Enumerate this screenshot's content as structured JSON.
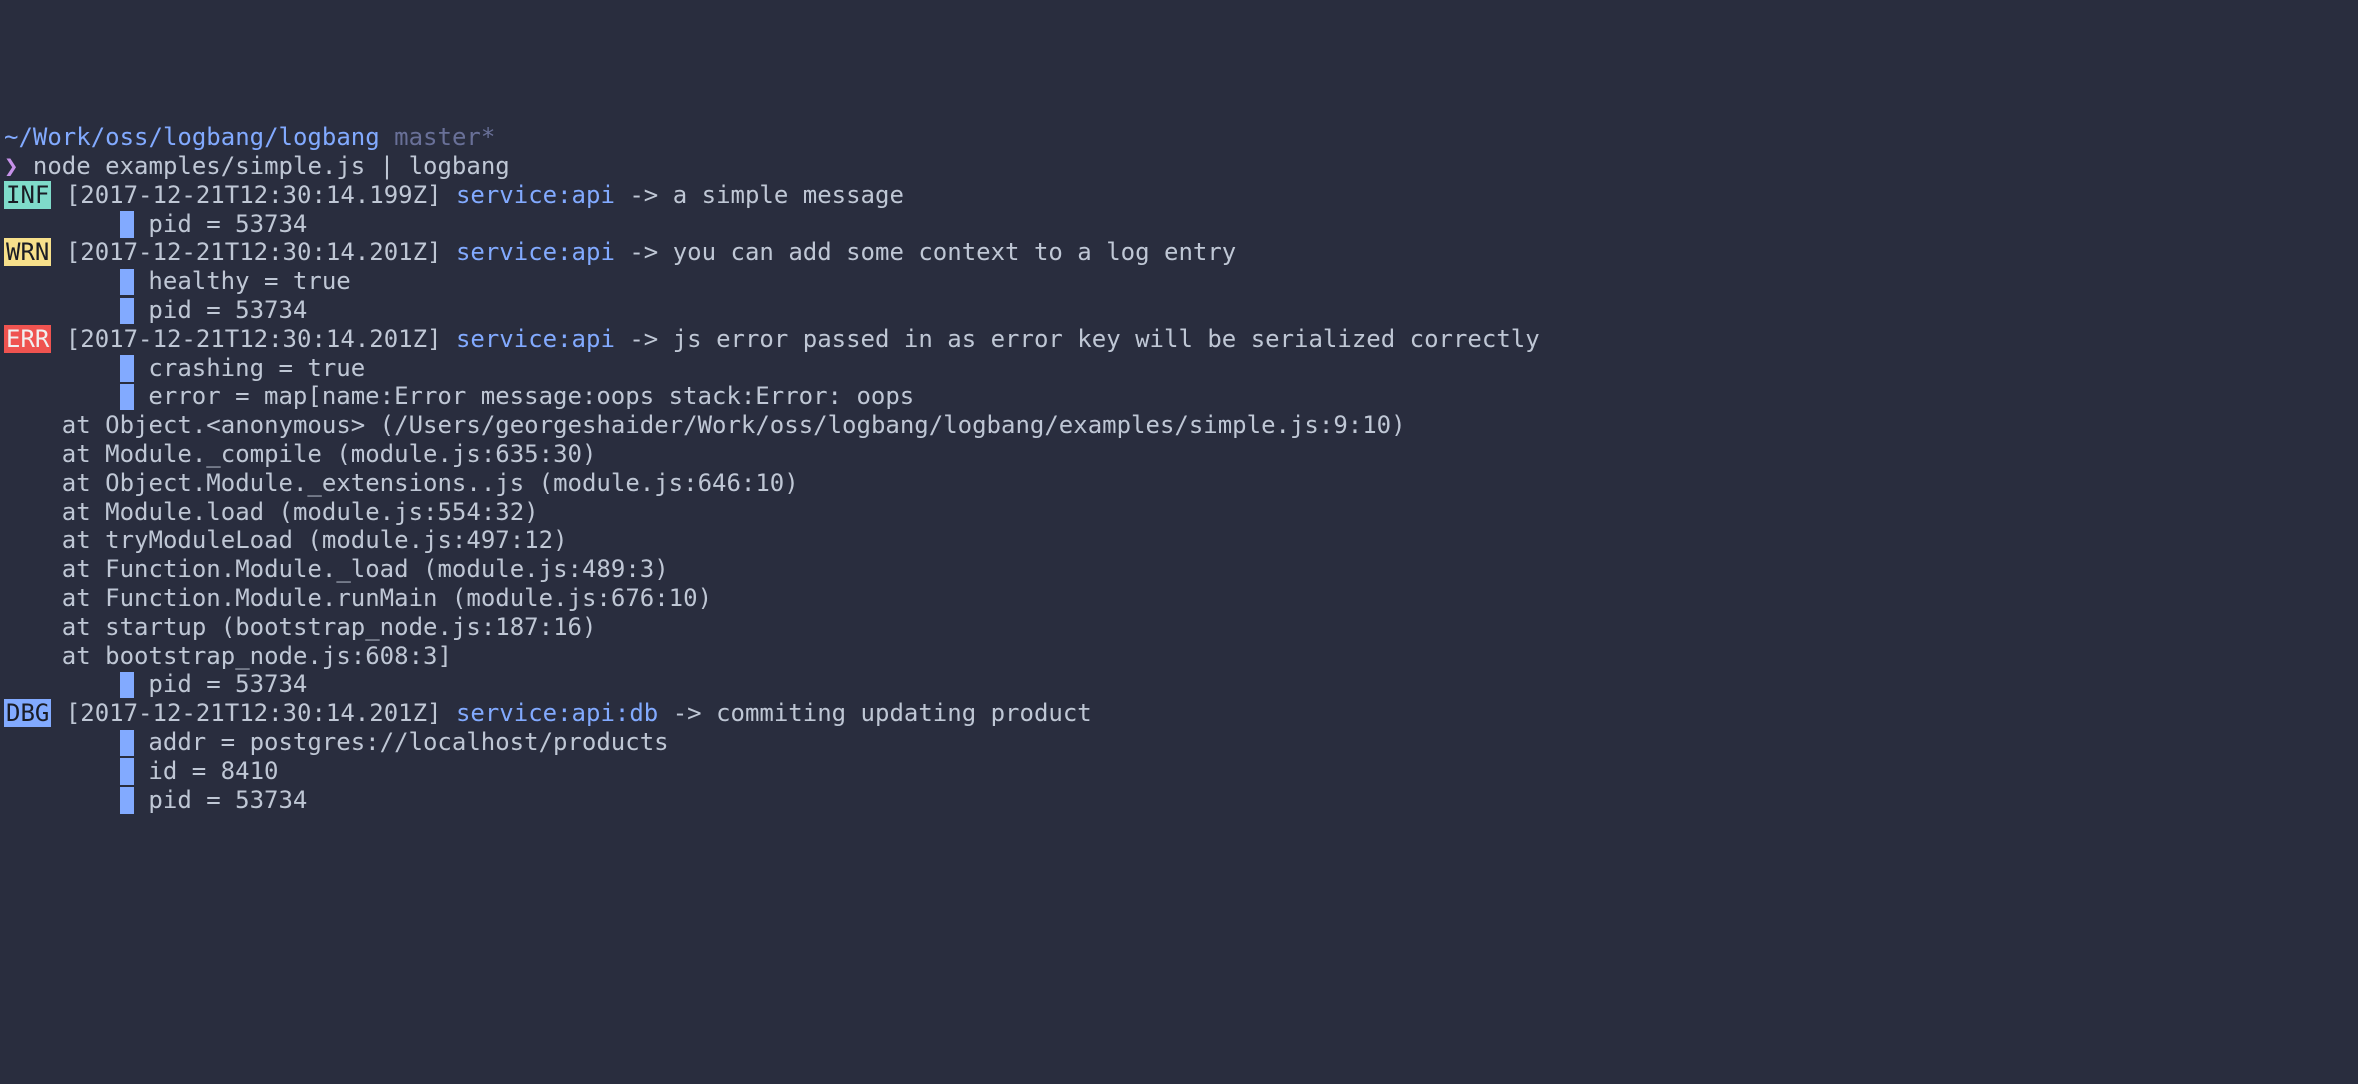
{
  "prompt": {
    "cwd": "~/Work/oss/logbang/logbang",
    "branch": "master*",
    "symbol": "❯",
    "command": "node examples/simple.js | logbang"
  },
  "entries": [
    {
      "level": "INF",
      "level_class": "level-inf",
      "timestamp": "[2017-12-21T12:30:14.199Z]",
      "service": "service:api",
      "arrow": "->",
      "message": "a simple message",
      "fields": [
        "pid = 53734"
      ],
      "stack": []
    },
    {
      "level": "WRN",
      "level_class": "level-wrn",
      "timestamp": "[2017-12-21T12:30:14.201Z]",
      "service": "service:api",
      "arrow": "->",
      "message": "you can add some context to a log entry",
      "fields": [
        "healthy = true",
        "pid = 53734"
      ],
      "stack": []
    },
    {
      "level": "ERR",
      "level_class": "level-err",
      "timestamp": "[2017-12-21T12:30:14.201Z]",
      "service": "service:api",
      "arrow": "->",
      "message": "js error passed in as error key will be serialized correctly",
      "fields": [
        "crashing = true",
        "error = map[name:Error message:oops stack:Error: oops"
      ],
      "stack": [
        "    at Object.<anonymous> (/Users/georgeshaider/Work/oss/logbang/logbang/examples/simple.js:9:10)",
        "    at Module._compile (module.js:635:30)",
        "    at Object.Module._extensions..js (module.js:646:10)",
        "    at Module.load (module.js:554:32)",
        "    at tryModuleLoad (module.js:497:12)",
        "    at Function.Module._load (module.js:489:3)",
        "    at Function.Module.runMain (module.js:676:10)",
        "    at startup (bootstrap_node.js:187:16)",
        "    at bootstrap_node.js:608:3]"
      ],
      "fields_after_stack": [
        "pid = 53734"
      ]
    },
    {
      "level": "DBG",
      "level_class": "level-dbg",
      "timestamp": "[2017-12-21T12:30:14.201Z]",
      "service": "service:api:db",
      "arrow": "->",
      "message": "commiting updating product",
      "fields": [
        "addr = postgres://localhost/products",
        "id = 8410",
        "pid = 53734"
      ],
      "stack": []
    }
  ]
}
